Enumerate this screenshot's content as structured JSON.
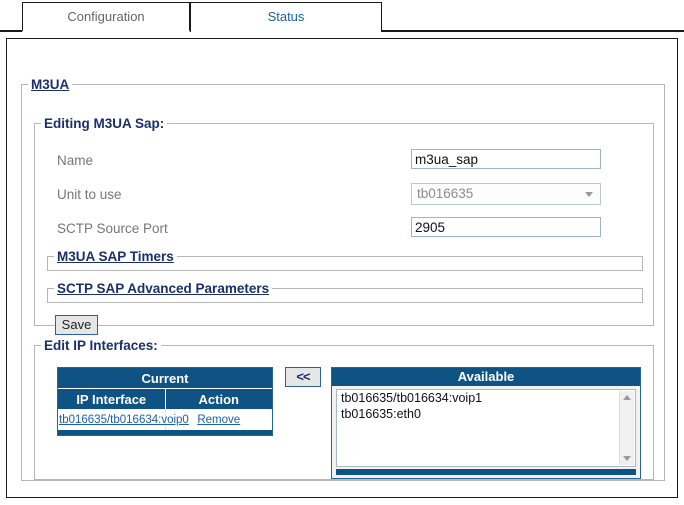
{
  "tabs": [
    {
      "label": "Configuration",
      "active": true
    },
    {
      "label": "Status",
      "active": false
    }
  ],
  "panel": {
    "m3ua_legend": "M3UA",
    "editing_legend": "Editing M3UA Sap:",
    "timers_legend": "M3UA SAP Timers",
    "sctp_advanced_legend": "SCTP SAP Advanced Parameters",
    "ip_interfaces_legend": "Edit IP Interfaces:"
  },
  "form": {
    "name": {
      "label": "Name",
      "value": "m3ua_sap",
      "placeholder": ""
    },
    "unit": {
      "label": "Unit to use",
      "value": "tb016635",
      "disabled": true
    },
    "sctp_port": {
      "label": "SCTP Source Port",
      "value": "2905",
      "placeholder": ""
    },
    "save_label": "Save"
  },
  "ip_interfaces": {
    "move_button_label": "<<",
    "current": {
      "title": "Current",
      "columns": [
        "IP Interface",
        "Action"
      ],
      "rows": [
        {
          "interface": "tb016635/tb016634:voip0",
          "action": "Remove"
        }
      ]
    },
    "available": {
      "title": "Available",
      "items": [
        "tb016635/tb016634:voip1",
        "tb016635:eth0"
      ]
    }
  },
  "colors": {
    "header_navy": "#0e5384",
    "legend_navy": "#1a2f6b",
    "link_blue": "#1b5fa8",
    "label_gray": "#777777"
  }
}
